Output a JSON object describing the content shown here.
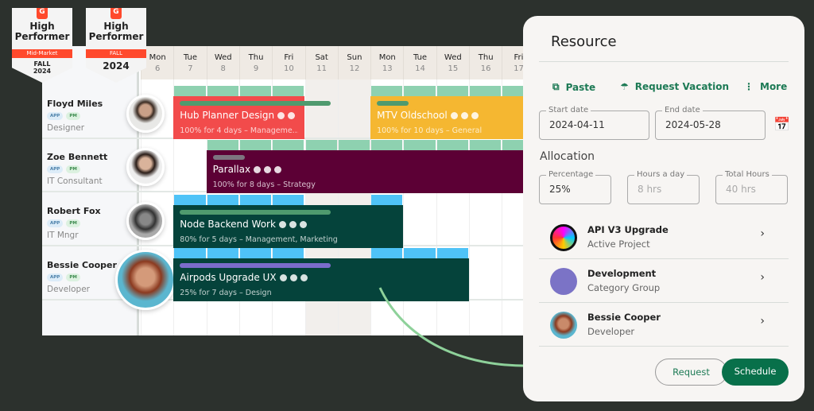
{
  "badges": [
    {
      "title": "High Performer",
      "ribbon": "Mid-Market",
      "season": "FALL 2024"
    },
    {
      "title": "High Performer",
      "ribbon": "FALL",
      "season": "2024"
    }
  ],
  "days": [
    {
      "d": "Mon",
      "n": "6"
    },
    {
      "d": "Tue",
      "n": "7"
    },
    {
      "d": "Wed",
      "n": "8"
    },
    {
      "d": "Thu",
      "n": "9"
    },
    {
      "d": "Fri",
      "n": "10"
    },
    {
      "d": "Sat",
      "n": "11"
    },
    {
      "d": "Sun",
      "n": "12"
    },
    {
      "d": "Mon",
      "n": "13"
    },
    {
      "d": "Tue",
      "n": "14"
    },
    {
      "d": "Wed",
      "n": "15"
    },
    {
      "d": "Thu",
      "n": "16"
    },
    {
      "d": "Fri",
      "n": "17"
    }
  ],
  "people": [
    {
      "name": "Floyd Miles",
      "role": "Designer",
      "tags": [
        "APP",
        "PM"
      ]
    },
    {
      "name": "Zoe Bennett",
      "role": "IT Consultant",
      "tags": [
        "APP",
        "PM"
      ]
    },
    {
      "name": "Robert Fox",
      "role": "IT Mngr",
      "tags": [
        "APP",
        "PM"
      ]
    },
    {
      "name": "Bessie Cooper",
      "role": "Developer",
      "tags": [
        "APP",
        "PM"
      ]
    }
  ],
  "bookings": [
    {
      "title": "Hub Planner Design",
      "sub": "100% for 4 days – Manageme...",
      "color": "#f24b4b",
      "pill": "#4f9a6e"
    },
    {
      "title": "MTV Oldschool",
      "sub": "100% for 10 days – General",
      "color": "#f5b731",
      "pill": "#4f9a6e"
    },
    {
      "title": "Parallax",
      "sub": "100% for 8 days – Strategy",
      "color": "#5c0035",
      "pill": "#7d7580"
    },
    {
      "title": "Node Backend Work",
      "sub": "80% for 5 days – Management, Marketing",
      "color": "#05433b",
      "pill": "#4f9a6e"
    },
    {
      "title": "Airpods Upgrade UX",
      "sub": "25% for 7 days – Design",
      "color": "#05433b",
      "pill": "#7b6ccc"
    }
  ],
  "panel": {
    "title": "Resource",
    "paste": "Paste",
    "vacation": "Request Vacation",
    "more": "More",
    "start_label": "Start date",
    "start": "2024-04-11",
    "end_label": "End date",
    "end": "2024-05-28",
    "allocation": "Allocation",
    "pct_label": "Percentage",
    "pct": "25%",
    "hpd_label": "Hours a day",
    "hpd": "8 hrs",
    "total_label": "Total Hours",
    "total": "40 hrs",
    "items": [
      {
        "a": "API V3 Upgrade",
        "b": "Active Project"
      },
      {
        "a": "Development",
        "b": "Category Group",
        "color": "#7b73c6"
      },
      {
        "a": "Bessie Cooper",
        "b": "Developer"
      }
    ],
    "request": "Request",
    "schedule": "Schedule"
  },
  "colors": {
    "accent": "#08704a",
    "strip_green": "#8ed1b0",
    "strip_blue": "#4fc3f7"
  }
}
